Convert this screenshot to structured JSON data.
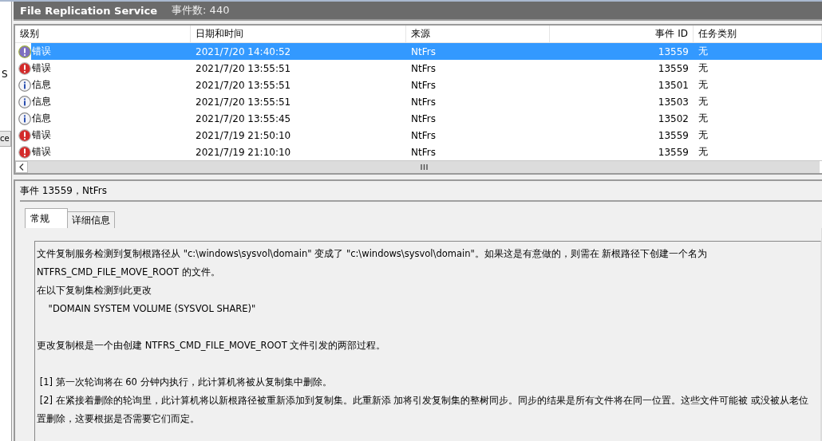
{
  "left_pane": {
    "items": [
      {
        "text": "S",
        "kind": "label"
      },
      {
        "text": "ce",
        "kind": "button"
      }
    ]
  },
  "header": {
    "title": "File Replication Service",
    "count": "事件数: 440"
  },
  "table": {
    "columns": [
      "级别",
      "日期和时间",
      "来源",
      "事件 ID",
      "任务类别"
    ],
    "rows": [
      {
        "kind": "error",
        "level": "错误",
        "date": "2021/7/20 14:40:52",
        "source": "NtFrs",
        "event_id": "13559",
        "task": "无",
        "selected": true
      },
      {
        "kind": "error",
        "level": "错误",
        "date": "2021/7/20 13:55:51",
        "source": "NtFrs",
        "event_id": "13559",
        "task": "无",
        "selected": false
      },
      {
        "kind": "info",
        "level": "信息",
        "date": "2021/7/20 13:55:51",
        "source": "NtFrs",
        "event_id": "13501",
        "task": "无",
        "selected": false
      },
      {
        "kind": "info",
        "level": "信息",
        "date": "2021/7/20 13:55:51",
        "source": "NtFrs",
        "event_id": "13503",
        "task": "无",
        "selected": false
      },
      {
        "kind": "info",
        "level": "信息",
        "date": "2021/7/20 13:55:45",
        "source": "NtFrs",
        "event_id": "13502",
        "task": "无",
        "selected": false
      },
      {
        "kind": "error",
        "level": "错误",
        "date": "2021/7/19 21:50:10",
        "source": "NtFrs",
        "event_id": "13559",
        "task": "无",
        "selected": false
      },
      {
        "kind": "error",
        "level": "错误",
        "date": "2021/7/19 21:10:10",
        "source": "NtFrs",
        "event_id": "13559",
        "task": "无",
        "selected": false
      }
    ]
  },
  "details": {
    "title": "事件 13559，NtFrs",
    "tabs": [
      {
        "label": "常规",
        "selected": true
      },
      {
        "label": "详细信息",
        "selected": false
      }
    ],
    "paragraphs": [
      {
        "lines": [
          "文件复制服务检测到复制根路径从 \"c:\\windows\\sysvol\\domain\" 变成了 \"c:\\windows\\sysvol\\domain\"。如果这是有意做的，则需在 新根路径下创建一个名为",
          "NTFRS_CMD_FILE_MOVE_ROOT 的文件。",
          "在以下复制集检测到此更改",
          "    \"DOMAIN SYSTEM VOLUME (SYSVOL SHARE)\""
        ]
      },
      {
        "lines": [
          "更改复制根是一个由创建 NTFRS_CMD_FILE_MOVE_ROOT 文件引发的两部过程。"
        ]
      },
      {
        "lines": [
          " [1] 第一次轮询将在 60 分钟内执行，此计算机将被从复制集中删除。",
          " [2] 在紧接着删除的轮询里，此计算机将以新根路径被重新添加到复制集。此重新添 加将引发复制集的整树同步。同步的结果是所有文件将在同一位置。这些文件可能被 或没被从老位",
          "置删除，这要根据是否需要它们而定。"
        ]
      }
    ]
  }
}
